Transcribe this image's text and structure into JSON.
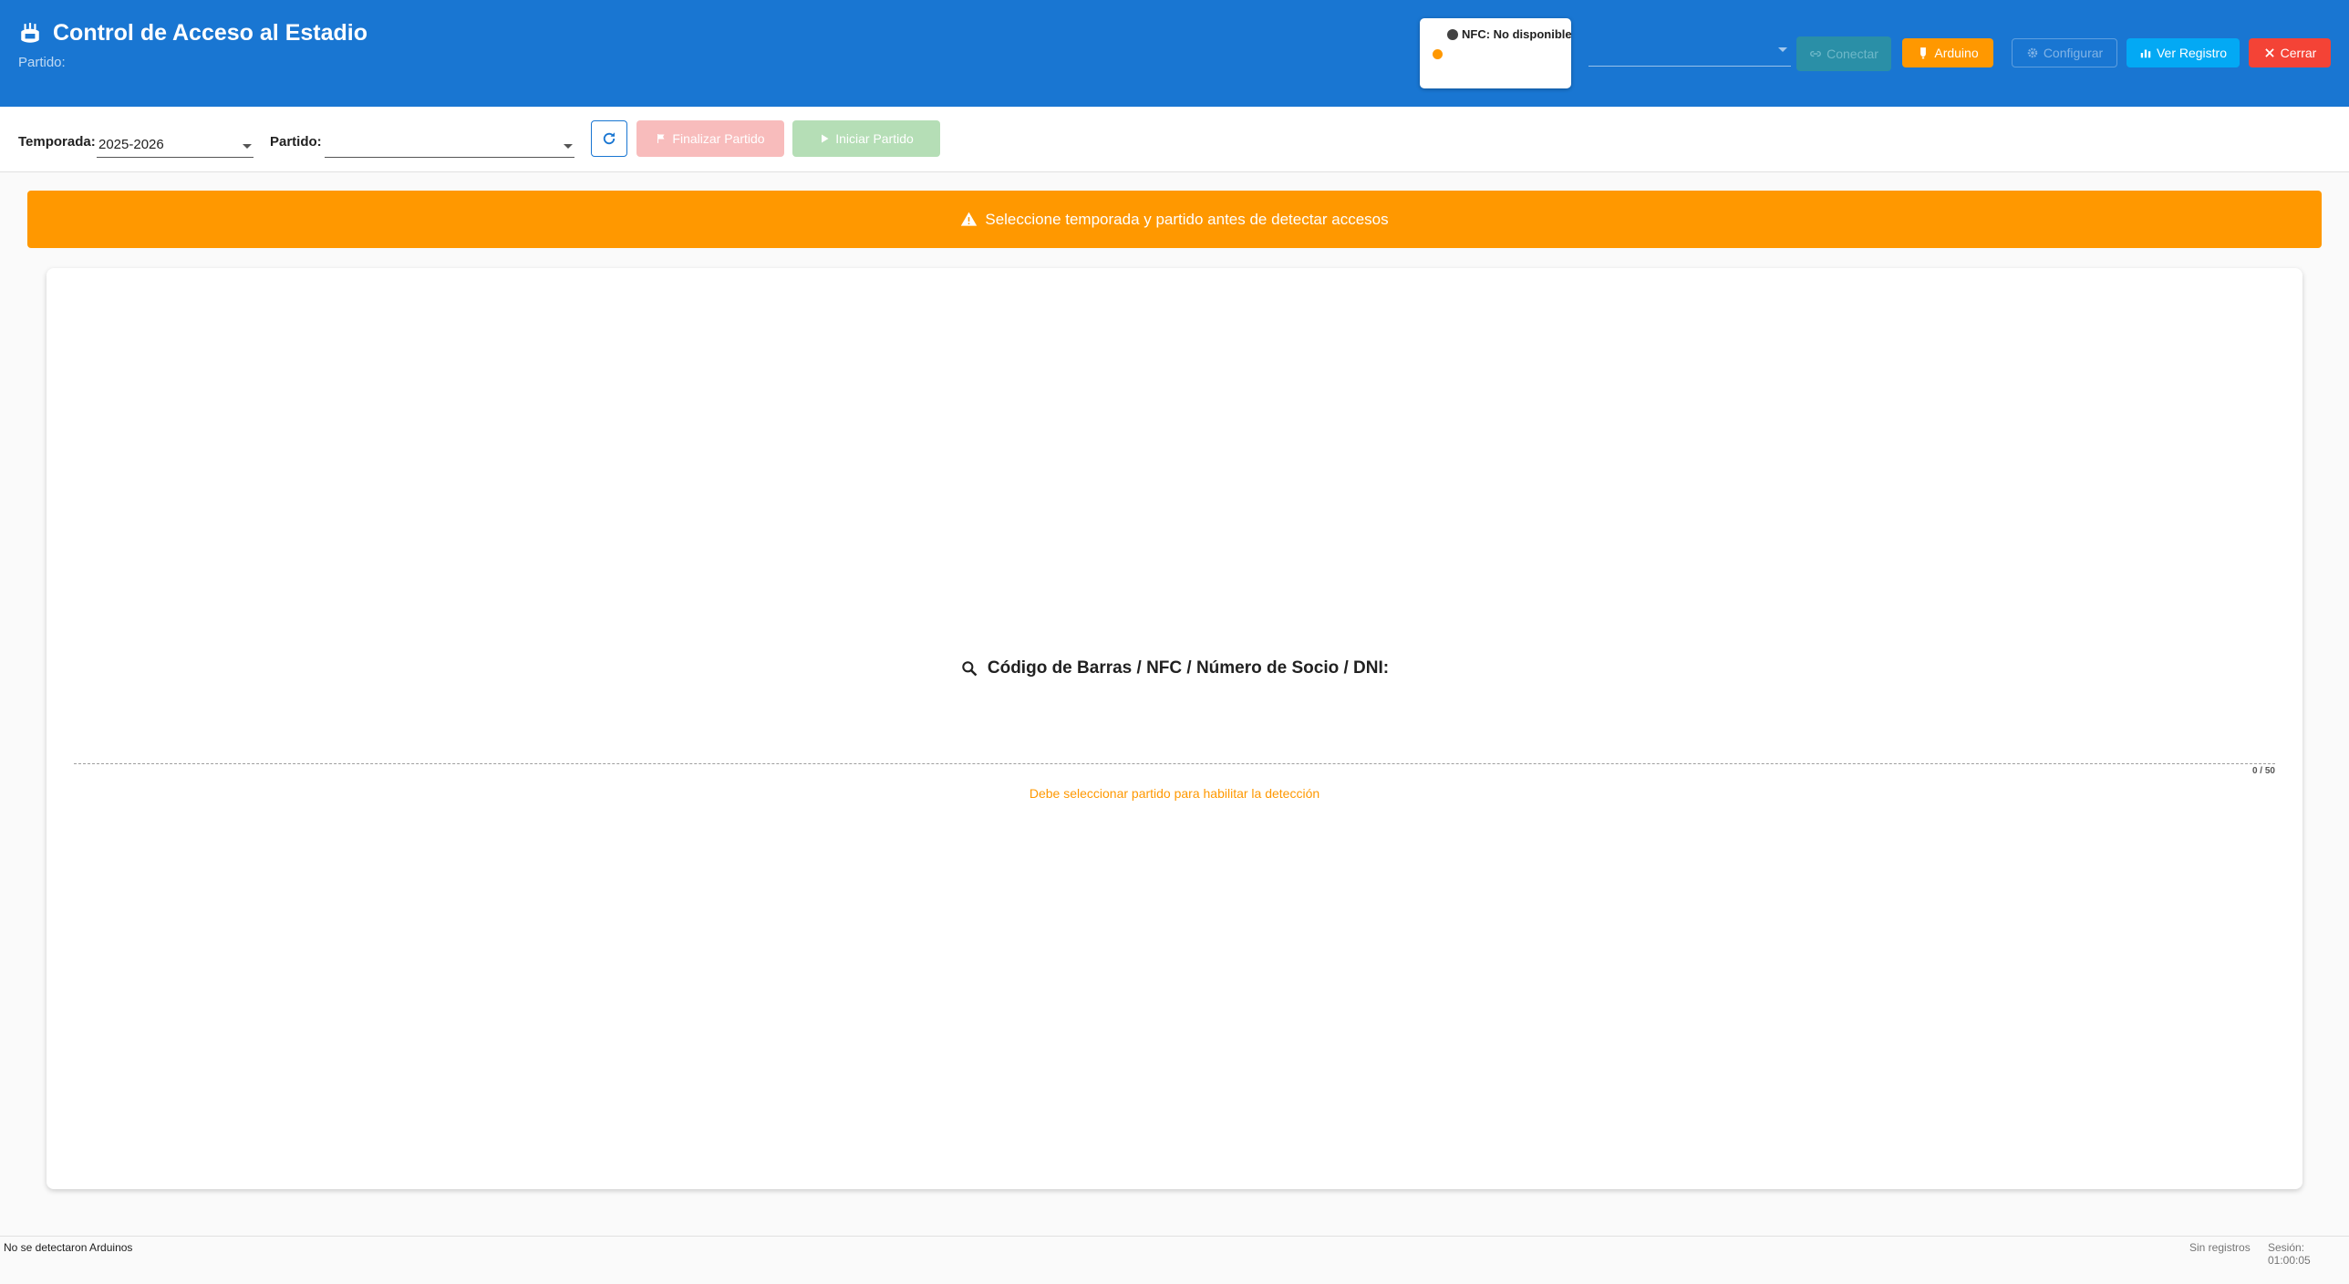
{
  "header": {
    "title": "Control de Acceso al Estadio",
    "subtitle": "Partido:",
    "icon": "stadium-icon",
    "nfc_status": "NFC: No disponible",
    "port_select_value": "",
    "buttons": {
      "conectar": "Conectar",
      "arduino": "Arduino",
      "configurar": "Configurar",
      "ver_registro": "Ver Registro",
      "cerrar": "Cerrar"
    }
  },
  "toolbar": {
    "temporada_label": "Temporada:",
    "temporada_value": "2025-2026",
    "partido_label": "Partido:",
    "partido_value": "",
    "finalizar_label": "Finalizar Partido",
    "iniciar_label": "Iniciar Partido"
  },
  "warning": {
    "text": "Seleccione temporada y partido antes de detectar accesos"
  },
  "main": {
    "search_label": "Código de Barras / NFC / Número de Socio / DNI:",
    "input_value": "",
    "counter": "0 / 50",
    "hint": "Debe seleccionar partido para habilitar la detección"
  },
  "footer": {
    "status": "No se detectaron Arduinos",
    "records": "Sin registros",
    "session": "Sesión: 01:00:05"
  },
  "colors": {
    "primary": "#1976d2",
    "warning": "#ff9800",
    "danger": "#f44336",
    "info": "#03a9f4"
  }
}
